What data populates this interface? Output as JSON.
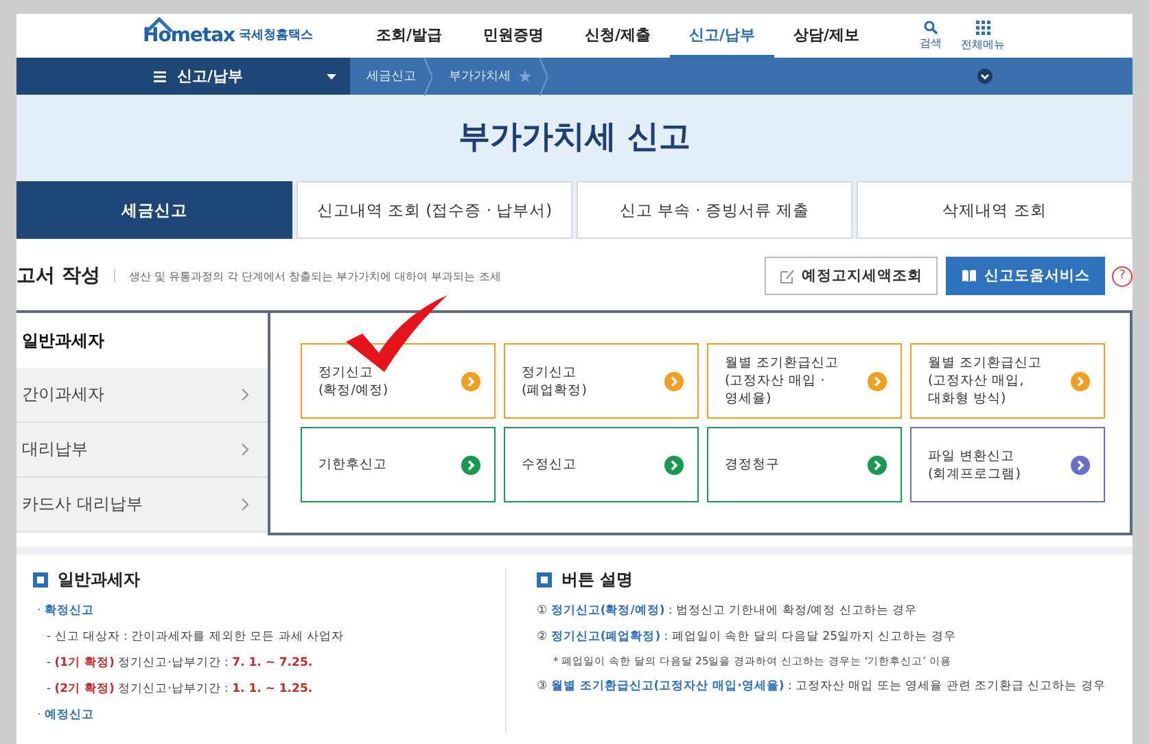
{
  "header": {
    "logo_text": "Hometax",
    "service_name": "국세청홈택스",
    "menu": [
      {
        "label": "조회/발급",
        "selected": false
      },
      {
        "label": "민원증명",
        "selected": false
      },
      {
        "label": "신청/제출",
        "selected": false
      },
      {
        "label": "신고/납부",
        "selected": true
      },
      {
        "label": "상담/제보",
        "selected": false
      }
    ],
    "tools": [
      {
        "kind": "search",
        "label": "검색"
      },
      {
        "kind": "grid",
        "label": "전체메뉴"
      }
    ]
  },
  "breadcrumb": {
    "menu": "신고/납부",
    "path": [
      "세금신고",
      "부가가치세"
    ]
  },
  "banner": {
    "title": "부가가치세 신고"
  },
  "tabs": [
    {
      "label": "세금신고",
      "selected": true
    },
    {
      "label": "신고내역 조회 (접수증 · 납부서)",
      "selected": false
    },
    {
      "label": "신고 부속 · 증빙서류 제출",
      "selected": false
    },
    {
      "label": "삭제내역 조회",
      "selected": false
    }
  ],
  "section": {
    "title": "고서 작성",
    "description": "생산 및 유통과정의 각 단계에서 창출되는 부가가치에 대하여 부과되는 조세",
    "buttons": [
      {
        "kind": "outline",
        "label": "예정고지세액조회"
      },
      {
        "kind": "primary",
        "label": "신고도움서비스"
      }
    ],
    "help": "?"
  },
  "sidebar": [
    {
      "label": "일반과세자",
      "selected": true
    },
    {
      "label": "간이과세자",
      "selected": false
    },
    {
      "label": "대리납부",
      "selected": false
    },
    {
      "label": "카드사 대리납부",
      "selected": false
    }
  ],
  "cards": [
    {
      "lines": [
        "정기신고",
        "(확정/예정)"
      ],
      "color": "#f0a020"
    },
    {
      "lines": [
        "정기신고",
        "(폐업확정)"
      ],
      "color": "#f0a020"
    },
    {
      "lines": [
        "월별 조기환급신고",
        "(고정자산 매입 ·",
        "영세율)"
      ],
      "color": "#f0a020"
    },
    {
      "lines": [
        "월별 조기환급신고",
        "(고정자산 매입,",
        "대화형 방식)"
      ],
      "color": "#f0a020"
    },
    {
      "lines": [
        "기한후신고"
      ],
      "color": "#1a9a50"
    },
    {
      "lines": [
        "수정신고"
      ],
      "color": "#1a9a50"
    },
    {
      "lines": [
        "경정청구"
      ],
      "color": "#1a9a50"
    },
    {
      "lines": [
        "파일 변환신고",
        "(회계프로그램)"
      ],
      "color": "#6670c8"
    }
  ],
  "info_left": {
    "title": "일반과세자",
    "items": [
      {
        "kind": "bullet",
        "text": "· **확정신고**"
      },
      {
        "kind": "dash",
        "text": "- 신고 대상자 : 간이과세자를 제외한 모든 과세 사업자"
      },
      {
        "kind": "dash",
        "text": "- **(1기 확정)** 정기신고·납부기간 : **7. 1. ~ 7.25.**"
      },
      {
        "kind": "dash",
        "text": "- **(2기 확정)** 정기신고·납부기간 : **1. 1. ~ 1.25.**"
      },
      {
        "kind": "bullet",
        "text": "· **예정신고**"
      }
    ]
  },
  "info_right": {
    "title": "버튼 설명",
    "items": [
      {
        "kind": "numbered",
        "number": "①",
        "term": "정기신고(확정/예정)",
        "text": " : 법정신고 기한내에 확정/예정 신고하는 경우"
      },
      {
        "kind": "numbered",
        "number": "②",
        "term": "정기신고(폐업확정)",
        "text": " : 폐업일이 속한 달의 다음달 25일까지 신고하는 경우"
      },
      {
        "kind": "note",
        "text": "* 폐업일이 속한 달의 다음달 25일을 경과하여 신고하는 경우는 ‘기한후신고’ 이용"
      },
      {
        "kind": "numbered",
        "number": "③",
        "term": "월별 조기환급신고(고정자산 매입·영세율)",
        "text": " : 고정자산 매입 또는 영세율 관련 조기환급 신고하는 경우"
      }
    ]
  }
}
